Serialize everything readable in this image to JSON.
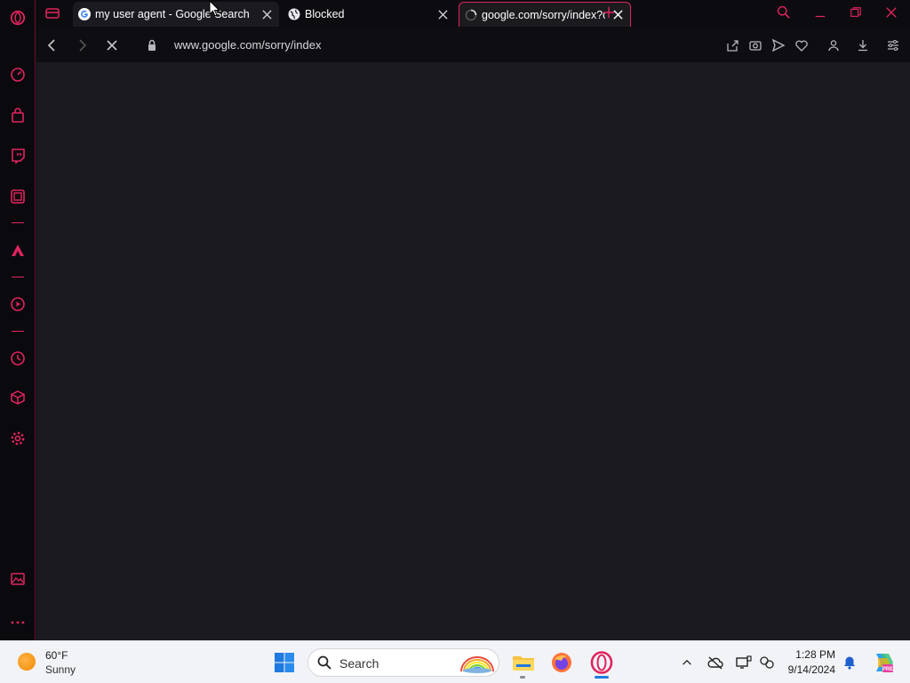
{
  "browser": {
    "tabs": [
      {
        "title": "my user agent - Google Search",
        "favicon": "google-icon",
        "active": false
      },
      {
        "title": "Blocked",
        "favicon": "globe-icon",
        "active": false
      },
      {
        "title": "google.com/sorry/index?continue",
        "favicon": "loading-spinner-icon",
        "active": true
      }
    ],
    "address_bar": {
      "url": "www.google.com/sorry/index"
    },
    "accent_color": "#e0245e"
  },
  "sidebar": {
    "items": [
      "speed-dial-icon",
      "shop-icon",
      "twitch-icon",
      "news-icon",
      "vivaldi-icon",
      "player-icon",
      "history-icon",
      "extensions-icon",
      "settings-icon",
      "gallery-icon",
      "more-icon"
    ]
  },
  "taskbar": {
    "weather": {
      "temp": "60°F",
      "desc": "Sunny"
    },
    "search_placeholder": "Search",
    "clock": {
      "time": "1:28 PM",
      "date": "9/14/2024"
    }
  }
}
